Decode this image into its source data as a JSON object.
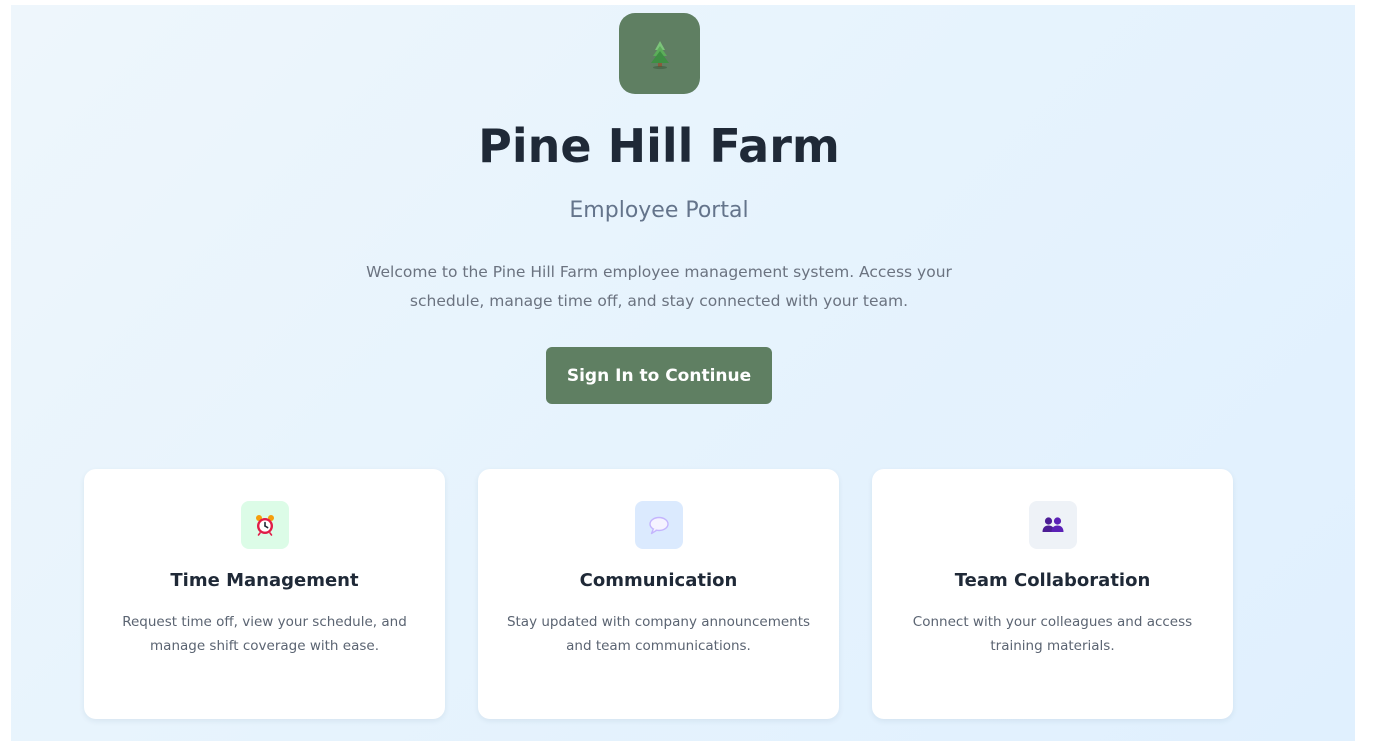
{
  "brand": {
    "logo_icon": "pine-tree-icon",
    "title": "Pine Hill Farm",
    "subtitle": "Employee Portal",
    "welcome": "Welcome to the Pine Hill Farm employee management system. Access your schedule, manage time off, and stay connected with your team."
  },
  "cta": {
    "label": "Sign In to Continue"
  },
  "features": [
    {
      "icon": "alarm-clock-icon",
      "title": "Time Management",
      "description": "Request time off, view your schedule, and manage shift coverage with ease."
    },
    {
      "icon": "speech-bubble-icon",
      "title": "Communication",
      "description": "Stay updated with company announcements and team communications."
    },
    {
      "icon": "people-icon",
      "title": "Team Collaboration",
      "description": "Connect with your colleagues and access training materials."
    }
  ],
  "colors": {
    "brand_green": "#5f7f62",
    "title_text": "#1f2937",
    "muted_text": "#64748b",
    "icon_bg_time": "#dcfce7",
    "icon_bg_communication": "#dbeafe",
    "icon_bg_team": "#eef2f7"
  }
}
